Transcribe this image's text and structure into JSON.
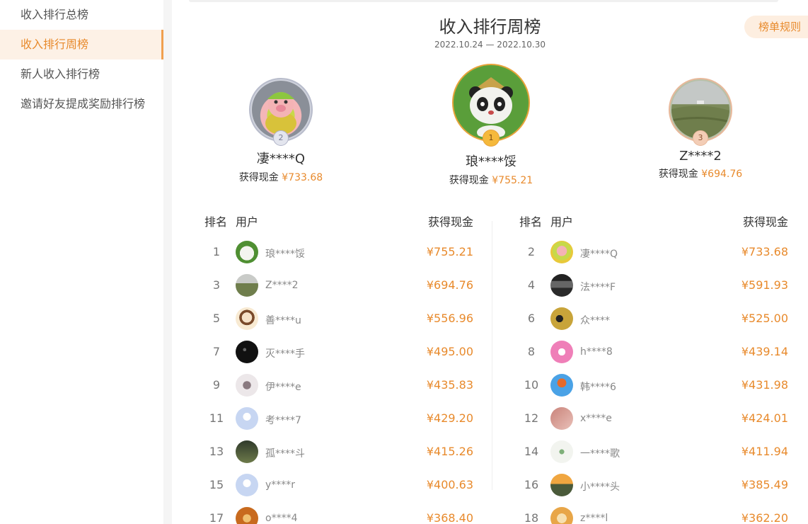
{
  "sidebar": {
    "items": [
      {
        "label": "收入排行总榜"
      },
      {
        "label": "收入排行周榜",
        "active": true
      },
      {
        "label": "新人收入排行榜"
      },
      {
        "label": "邀请好友提成奖励排行榜"
      }
    ]
  },
  "header": {
    "title": "收入排行周榜",
    "date_range": "2022.10.24 — 2022.10.30",
    "rules_label": "榜单规则"
  },
  "podium": {
    "first": {
      "rank": "1",
      "name": "琅****馁",
      "cash_label": "获得现金",
      "amount": "¥755.21"
    },
    "second": {
      "rank": "2",
      "name": "凄****Q",
      "cash_label": "获得现金",
      "amount": "¥733.68"
    },
    "third": {
      "rank": "3",
      "name": "Z****2",
      "cash_label": "获得现金",
      "amount": "¥694.76"
    }
  },
  "table": {
    "col_rank": "排名",
    "col_user": "用户",
    "col_cash": "获得现金",
    "left_rows": [
      {
        "rank": "1",
        "user": "琅****馁",
        "cash": "¥755.21",
        "avatar": "panda"
      },
      {
        "rank": "3",
        "user": "Z****2",
        "cash": "¥694.76",
        "avatar": "field"
      },
      {
        "rank": "5",
        "user": "善****u",
        "cash": "¥556.96",
        "avatar": "girl"
      },
      {
        "rank": "7",
        "user": "灭****手",
        "cash": "¥495.00",
        "avatar": "dark"
      },
      {
        "rank": "9",
        "user": "伊****e",
        "cash": "¥435.83",
        "avatar": "sketch"
      },
      {
        "rank": "11",
        "user": "考****7",
        "cash": "¥429.20",
        "avatar": "default"
      },
      {
        "rank": "13",
        "user": "孤****斗",
        "cash": "¥415.26",
        "avatar": "night"
      },
      {
        "rank": "15",
        "user": "y****r",
        "cash": "¥400.63",
        "avatar": "default"
      },
      {
        "rank": "17",
        "user": "o****4",
        "cash": "¥368.40",
        "avatar": "lion"
      }
    ],
    "right_rows": [
      {
        "rank": "2",
        "user": "凄****Q",
        "cash": "¥733.68",
        "avatar": "pig"
      },
      {
        "rank": "4",
        "user": "法****F",
        "cash": "¥591.93",
        "avatar": "building"
      },
      {
        "rank": "6",
        "user": "众****",
        "cash": "¥525.00",
        "avatar": "silhouette"
      },
      {
        "rank": "8",
        "user": "h****8",
        "cash": "¥439.14",
        "avatar": "pink"
      },
      {
        "rank": "10",
        "user": "韩****6",
        "cash": "¥431.98",
        "avatar": "balloon"
      },
      {
        "rank": "12",
        "user": "x****e",
        "cash": "¥424.01",
        "avatar": "hand"
      },
      {
        "rank": "14",
        "user": "一****歌",
        "cash": "¥411.94",
        "avatar": "plant"
      },
      {
        "rank": "16",
        "user": "小****头",
        "cash": "¥385.49",
        "avatar": "sunset"
      },
      {
        "rank": "18",
        "user": "z****l",
        "cash": "¥362.20",
        "avatar": "dog"
      }
    ]
  },
  "colors": {
    "accent": "#e88a2c",
    "accent_bg": "#fdf1e6",
    "gold": "#e8a33a",
    "silver": "#b0b4c8",
    "bronze": "#e8b89a"
  }
}
